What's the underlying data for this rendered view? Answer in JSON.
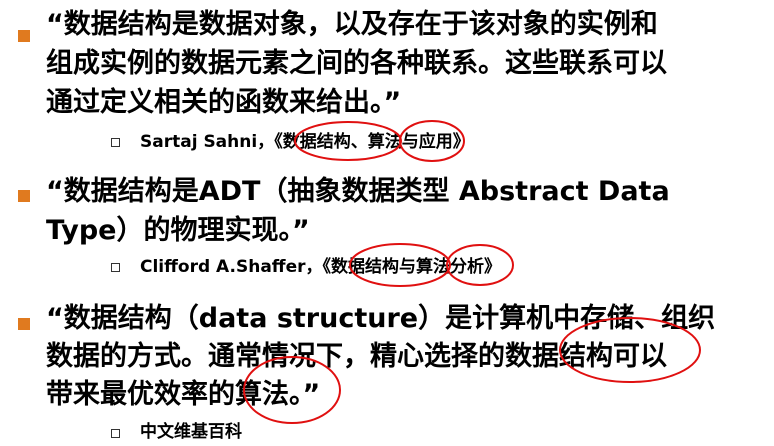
{
  "quotes": [
    {
      "lines": [
        "“数据结构是数据对象，以及存在于该对象的实例和",
        "组成实例的数据元素之间的各种联系。这些联系可以",
        "通过定义相关的函数来给出。”"
      ],
      "source": "Sartaj Sahni，《数据结构、算法与应用》"
    },
    {
      "lines": [
        "“数据结构是ADT（抽象数据类型 Abstract Data",
        "Type）的物理实现。”"
      ],
      "source": "Clifford A.Shaffer，《数据结构与算法分析》"
    },
    {
      "lines": [
        "“数据结构（data structure）是计算机中存储、组织",
        "数据的方式。通常情况下，精心选择的数据结构可以",
        "带来最优效率的算法。”"
      ],
      "source": "中文维基百科"
    }
  ],
  "colors": {
    "bullet": "#e07a1f",
    "annotation": "#e01010"
  }
}
